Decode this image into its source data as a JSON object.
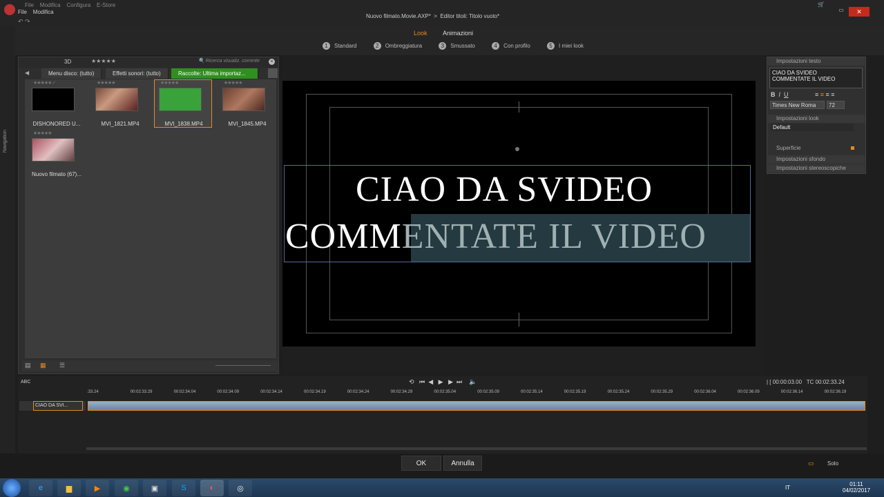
{
  "window": {
    "menu": [
      "File",
      "Modifica",
      "Configura",
      "E-Store"
    ],
    "menu2": [
      "File",
      "Modifica"
    ],
    "breadcrumb1": "Nuovo filmato.Movie.AXP*",
    "breadcrumb_sep": ">",
    "breadcrumb2": "Editor titoli: Titolo vuoto*"
  },
  "look_tabs": {
    "look": "Look",
    "animazioni": "Animazioni"
  },
  "steps": [
    {
      "n": "1",
      "label": "Standard"
    },
    {
      "n": "2",
      "label": "Ombreggiatura"
    },
    {
      "n": "3",
      "label": "Smussato"
    },
    {
      "n": "4",
      "label": "Con profilo"
    },
    {
      "n": "5",
      "label": "I miei look"
    }
  ],
  "library": {
    "mode_3d": "3D",
    "stars": "★★★★★",
    "search_placeholder": "Ricerca visualiz. corrente",
    "tabs": [
      "Menu disco: (tutto)",
      "Effetti sonori: (tutto)",
      "Raccolte: Ultima importaz..."
    ],
    "items": [
      {
        "label": "DISHONORED U...",
        "stars": "★★★★★ ✓"
      },
      {
        "label": "MVI_1821.MP4",
        "stars": "★★★★★"
      },
      {
        "label": "MVI_1838.MP4",
        "stars": "★★★★★"
      },
      {
        "label": "MVI_1845.MP4",
        "stars": "★★★★★"
      },
      {
        "label": "Nuovo filmato (67)...",
        "stars": "★★★★★"
      }
    ],
    "side_label": "Navigation"
  },
  "title_text": {
    "line1": "CIAO DA SVIDEO",
    "line2a": "COMM",
    "line2b": "ENTATE IL VIDEO"
  },
  "props": {
    "text_settings": "Impostazioni testo",
    "text_value_1": "CIAO DA SVIDEO",
    "text_value_2": "COMMENTATE IL VIDEO",
    "font": "Times New Roma",
    "size": "72",
    "look_settings": "Impostazioni look",
    "look_value": "Default",
    "superficie": "Superficie",
    "sfondo": "Impostazioni sfondo",
    "stereo": "Impostazioni stereoscopiche"
  },
  "timeline": {
    "abc": "ABC",
    "clip": "CIAO DA SVI...",
    "duration": "00:00:03.00",
    "tc_label": "TC",
    "tc": "00:02:33.24",
    "ticks": [
      ":33.24",
      "00:02:33.29",
      "00:02:34.04",
      "00:02:34.09",
      "00:02:34.14",
      "00:02:34.19",
      "00:02:34.24",
      "00:02:34.29",
      "00:02:35.04",
      "00:02:35.09",
      "00:02:35.14",
      "00:02:35.19",
      "00:02:35.24",
      "00:02:35.29",
      "00:02:36.04",
      "00:02:36.09",
      "00:02:36.14",
      "00:02:36.19"
    ]
  },
  "bottom": {
    "ok": "OK",
    "cancel": "Annulla",
    "solo": "Solo"
  },
  "taskbar": {
    "lang": "IT",
    "time": "01:11",
    "date": "04/02/2017"
  }
}
